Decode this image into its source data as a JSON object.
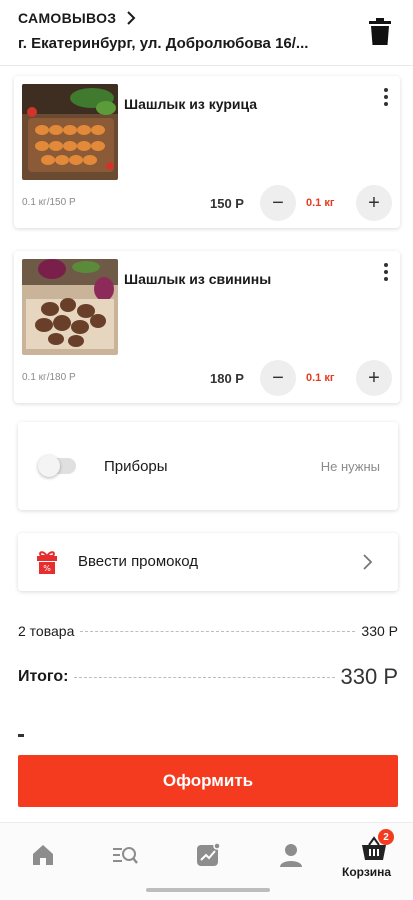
{
  "header": {
    "pickup_label": "САМОВЫВОЗ",
    "address": "г. Екатеринбург, ул. Добролюбова 16/..."
  },
  "cart_items": [
    {
      "title": "Шашлык из курица",
      "unit_price": "0.1 кг/150 Р",
      "price": "150 Р",
      "quantity": "0.1 кг"
    },
    {
      "title": "Шашлык из свинины",
      "unit_price": "0.1 кг/180 Р",
      "price": "180 Р",
      "quantity": "0.1 кг"
    }
  ],
  "cutlery": {
    "label": "Приборы",
    "value": "Не нужны",
    "enabled": false
  },
  "promo": {
    "label": "Ввести промокод"
  },
  "summary": {
    "items_label": "2 товара",
    "items_total": "330 Р",
    "total_label": "Итого:",
    "total_value": "330 Р"
  },
  "checkout": {
    "label": "Оформить"
  },
  "nav": {
    "cart_label": "Корзина",
    "cart_badge": "2",
    "icons": [
      "home-icon",
      "menu-search-icon",
      "promo-chart-icon",
      "profile-icon",
      "basket-icon"
    ]
  },
  "colors": {
    "accent": "#f43b1f",
    "quantity_text": "#e63a1f"
  }
}
